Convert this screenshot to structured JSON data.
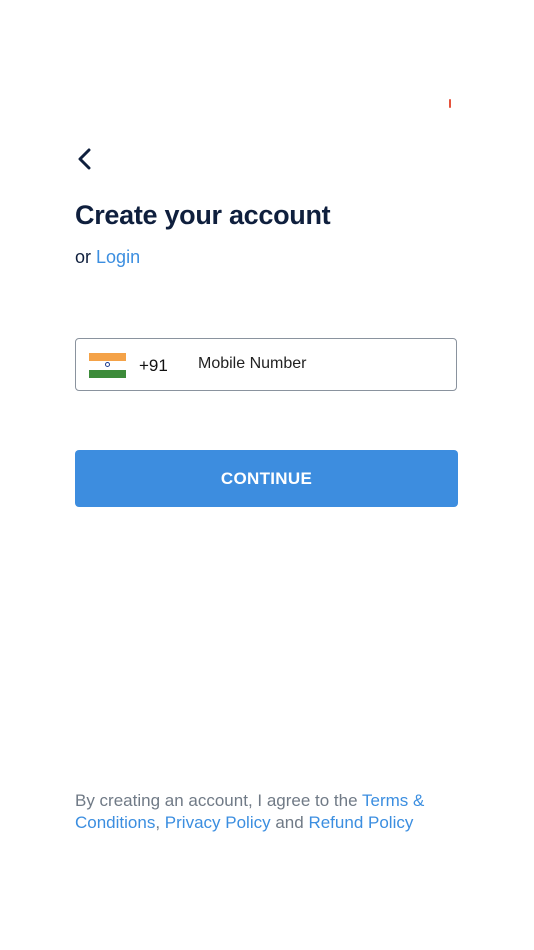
{
  "header": {
    "back_icon": "chevron-left-icon",
    "title": "Create your account"
  },
  "login": {
    "prefix": "or",
    "link_label": "Login"
  },
  "phone": {
    "flag_icon": "india-flag-icon",
    "country_code": "+91",
    "value": "",
    "placeholder": "Mobile Number"
  },
  "continue_label": "CONTINUE",
  "terms": {
    "prefix": "By creating an account, I agree to the",
    "terms_link": "Terms & Conditions",
    "separator": ",",
    "privacy_link": "Privacy Policy",
    "and": "and",
    "refund_link": "Refund Policy"
  },
  "colors": {
    "accent": "#3d8ddf",
    "link": "#3b8ee0",
    "title": "#0f1f3d",
    "muted": "#707a86",
    "status_mark": "#e5533d"
  }
}
